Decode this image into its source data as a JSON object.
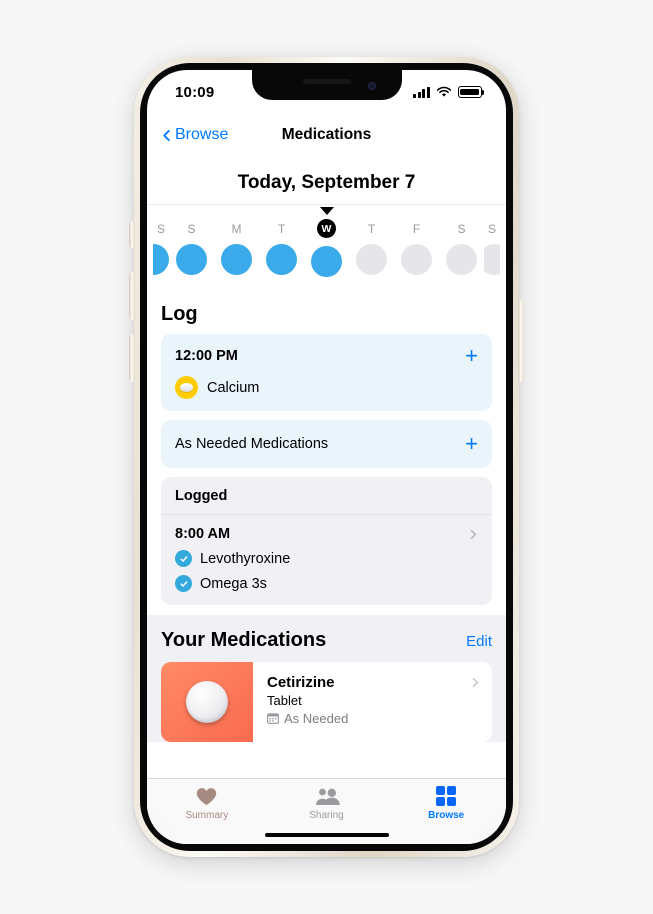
{
  "status_bar": {
    "time": "10:09",
    "signal_icon": "cellular-signal-icon",
    "wifi_icon": "wifi-icon",
    "battery_icon": "battery-full-icon"
  },
  "nav": {
    "back_label": "Browse",
    "back_icon": "chevron-left-icon",
    "title": "Medications"
  },
  "header": {
    "today_label": "Today, September 7",
    "caret_icon": "today-caret-icon"
  },
  "week_strip": {
    "days": [
      {
        "letter": "S",
        "state": "filled",
        "edge": "left"
      },
      {
        "letter": "S",
        "state": "filled",
        "edge": ""
      },
      {
        "letter": "M",
        "state": "filled",
        "edge": ""
      },
      {
        "letter": "T",
        "state": "filled",
        "edge": ""
      },
      {
        "letter": "W",
        "state": "filled",
        "edge": "",
        "today": true
      },
      {
        "letter": "T",
        "state": "empty",
        "edge": ""
      },
      {
        "letter": "F",
        "state": "empty",
        "edge": ""
      },
      {
        "letter": "S",
        "state": "empty",
        "edge": ""
      },
      {
        "letter": "S",
        "state": "empty",
        "edge": "right"
      }
    ]
  },
  "log": {
    "heading": "Log",
    "scheduled": {
      "time": "12:00 PM",
      "add_icon": "plus-icon",
      "medication": "Calcium",
      "medication_icon": "yellow-pill-icon"
    },
    "as_needed": {
      "title": "As Needed Medications",
      "add_icon": "plus-icon"
    },
    "logged": {
      "heading": "Logged",
      "time": "8:00 AM",
      "disclosure_icon": "chevron-right-icon",
      "items": [
        {
          "name": "Levothyroxine",
          "icon": "check-circle-icon"
        },
        {
          "name": "Omega 3s",
          "icon": "check-circle-icon"
        }
      ]
    }
  },
  "your_medications": {
    "title": "Your Medications",
    "edit_label": "Edit",
    "items": [
      {
        "name": "Cetirizine",
        "form": "Tablet",
        "schedule": "As Needed",
        "schedule_icon": "calendar-icon",
        "thumb_icon": "white-round-tablet-icon",
        "thumb_color": "#fa6a4e",
        "disclosure_icon": "chevron-right-icon"
      }
    ]
  },
  "tab_bar": {
    "tabs": [
      {
        "label": "Summary",
        "icon": "heart-icon",
        "selected": false
      },
      {
        "label": "Sharing",
        "icon": "people-icon",
        "selected": false
      },
      {
        "label": "Browse",
        "icon": "grid-icon",
        "selected": true
      }
    ]
  },
  "colors": {
    "accent_blue": "#007aff",
    "dot_blue": "#3aaaeb",
    "pill_yellow": "#ffcc00",
    "card_blue": "#eaf4fb",
    "group_gray": "#f1f1f5",
    "tile_orange": "#fa6a4e"
  }
}
